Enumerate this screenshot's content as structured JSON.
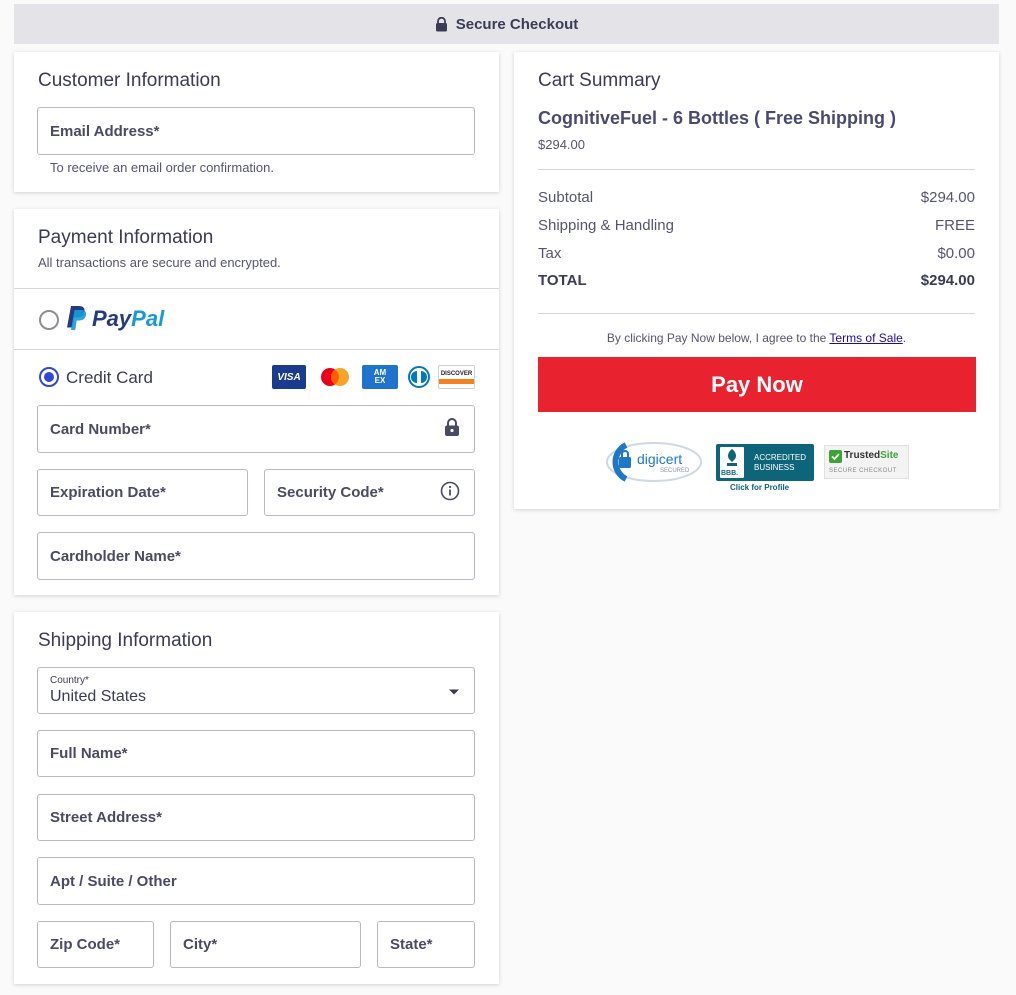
{
  "header": {
    "title": "Secure Checkout",
    "icon": "lock-icon"
  },
  "customer": {
    "title": "Customer Information",
    "email_label": "Email Address*",
    "email_help": "To receive an email order confirmation."
  },
  "payment": {
    "title": "Payment Information",
    "subtitle": "All transactions are secure and encrypted.",
    "paypal_label": "PayPal",
    "paypal_label_pay": "Pay",
    "paypal_label_pal": "Pal",
    "credit_card_label": "Credit Card",
    "card_logos": [
      "VISA",
      "Mastercard",
      "AMEX",
      "Diners Club",
      "DISCOVER"
    ],
    "card_number_label": "Card Number*",
    "expiration_label": "Expiration Date*",
    "security_code_label": "Security Code*",
    "cardholder_label": "Cardholder Name*",
    "selected_method": "Credit Card"
  },
  "shipping": {
    "title": "Shipping Information",
    "country_label": "Country*",
    "country_value": "United States",
    "full_name_label": "Full Name*",
    "street_label": "Street Address*",
    "apt_label": "Apt / Suite / Other",
    "zip_label": "Zip Code*",
    "city_label": "City*",
    "state_label": "State*"
  },
  "cart": {
    "title": "Cart Summary",
    "product_name": "CognitiveFuel - 6 Bottles ( Free Shipping )",
    "product_price": "$294.00",
    "rows": [
      {
        "label": "Subtotal",
        "value": "$294.00"
      },
      {
        "label": "Shipping & Handling",
        "value": "FREE"
      },
      {
        "label": "Tax",
        "value": "$0.00"
      },
      {
        "label": "TOTAL",
        "value": "$294.00"
      }
    ],
    "terms_prefix": "By clicking Pay Now below, I agree to the ",
    "terms_link": "Terms of Sale",
    "terms_suffix": ".",
    "pay_button": "Pay Now"
  },
  "badges": {
    "digicert_name": "digicert",
    "digicert_sub": "SECURED",
    "bbb_mark": "BBB.",
    "bbb_line1": "ACCREDITED",
    "bbb_line2": "BUSINESS",
    "bbb_caption": "Click for Profile",
    "trusted_name_a": "Trusted",
    "trusted_name_b": "Site",
    "trusted_sub": "SECURE CHECKOUT"
  },
  "colors": {
    "accent_red": "#e8222f",
    "radio_blue": "#3147d8",
    "paypal_dark": "#253b80",
    "paypal_light": "#179bd7",
    "bbb_teal": "#0e6479",
    "link": "#1a0dab"
  }
}
